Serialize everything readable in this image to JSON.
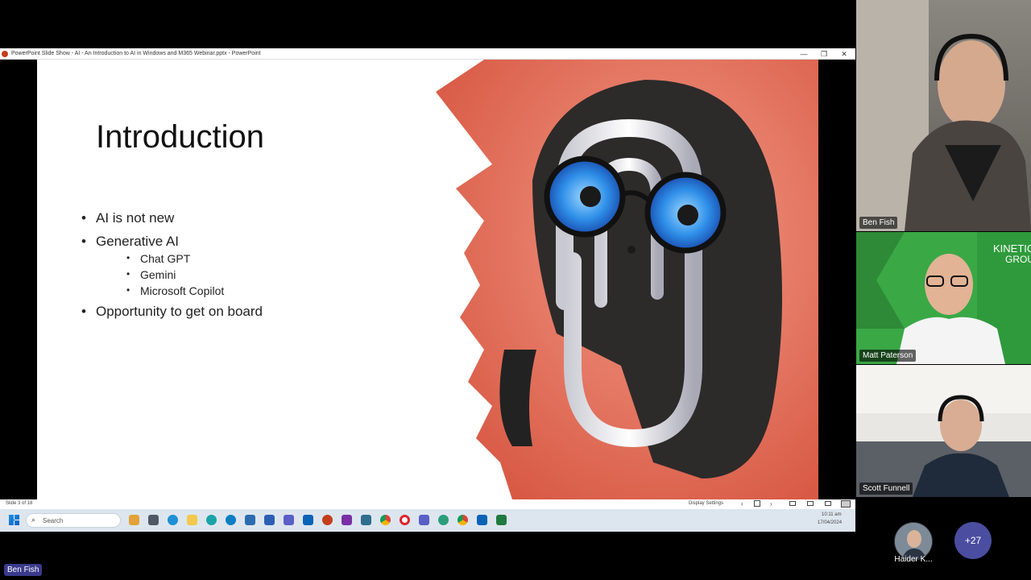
{
  "window": {
    "title": "PowerPoint Slide Show  -  AI - An Introduction to AI in Windows and M365 Webinar.pptx - PowerPoint",
    "minimize": "—",
    "restore": "❐",
    "close": "✕"
  },
  "slide": {
    "title": "Introduction",
    "bullets": [
      "AI is not new",
      "Generative AI",
      "Opportunity to get on board"
    ],
    "sub_bullets": [
      "Chat GPT",
      "Gemini",
      "Microsoft Copilot"
    ]
  },
  "statusbar": {
    "slide_counter": "Slide 3 of 18",
    "display_settings": "Display Settings"
  },
  "taskbar": {
    "search_placeholder": "Search",
    "time": "10:11 am",
    "date": "17/04/2024",
    "icons": [
      "widgets-icon",
      "task-view-icon",
      "edge-icon",
      "file-explorer-icon",
      "edge-beta-icon",
      "edge-dev-icon",
      "store-icon",
      "word-icon",
      "teams-icon",
      "outlook-icon",
      "powerpoint-icon",
      "onenote-icon",
      "calculator-icon",
      "chrome-icon",
      "opera-icon",
      "teams-new-icon",
      "edge-canary-icon",
      "chrome-beta-icon",
      "outlook-new-icon",
      "excel-icon"
    ]
  },
  "participants": {
    "p1": "Ben Fish",
    "p2": "Matt Paterson",
    "p3": "Scott Funnell",
    "p4": "Haider K...",
    "more": "+27"
  },
  "presenter_label": "Ben Fish",
  "colors": {
    "slide_bg": "#ffffff",
    "art_bg": "#e8735f",
    "kinetics_green": "#3aa845",
    "participant_badge": "#4b4ea0"
  }
}
